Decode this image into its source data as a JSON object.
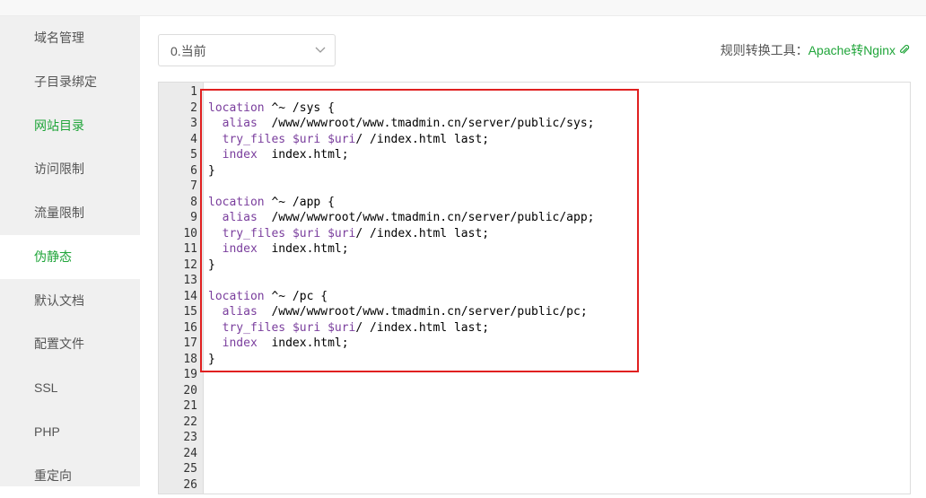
{
  "sidebar": {
    "items": [
      {
        "label": "域名管理"
      },
      {
        "label": "子目录绑定"
      },
      {
        "label": "网站目录"
      },
      {
        "label": "访问限制"
      },
      {
        "label": "流量限制"
      },
      {
        "label": "伪静态"
      },
      {
        "label": "默认文档"
      },
      {
        "label": "配置文件"
      },
      {
        "label": "SSL"
      },
      {
        "label": "PHP"
      },
      {
        "label": "重定向"
      }
    ]
  },
  "toolbar": {
    "select_value": "0.当前",
    "tool_label": "规则转换工具：",
    "tool_link": "Apache转Nginx"
  },
  "editor": {
    "line_numbers": [
      "1",
      "2",
      "3",
      "4",
      "5",
      "6",
      "7",
      "8",
      "9",
      "10",
      "11",
      "12",
      "13",
      "14",
      "15",
      "16",
      "17",
      "18",
      "19",
      "20",
      "21",
      "22",
      "23",
      "24",
      "25",
      "26"
    ],
    "lines": [
      "",
      "location ^~ /sys {",
      "  alias  /www/wwwroot/www.tmadmin.cn/server/public/sys;",
      "  try_files $uri $uri/ /index.html last;",
      "  index  index.html;",
      "}",
      "",
      "location ^~ /app {",
      "  alias  /www/wwwroot/www.tmadmin.cn/server/public/app;",
      "  try_files $uri $uri/ /index.html last;",
      "  index  index.html;",
      "}",
      "",
      "location ^~ /pc {",
      "  alias  /www/wwwroot/www.tmadmin.cn/server/public/pc;",
      "  try_files $uri $uri/ /index.html last;",
      "  index  index.html;",
      "}"
    ]
  },
  "colors": {
    "accent": "#20a53a",
    "highlight": "#e02020",
    "keyword": "#7a3e9d"
  },
  "icons": {
    "select_arrow": "chevron-down-icon",
    "link": "paperclip-icon"
  }
}
